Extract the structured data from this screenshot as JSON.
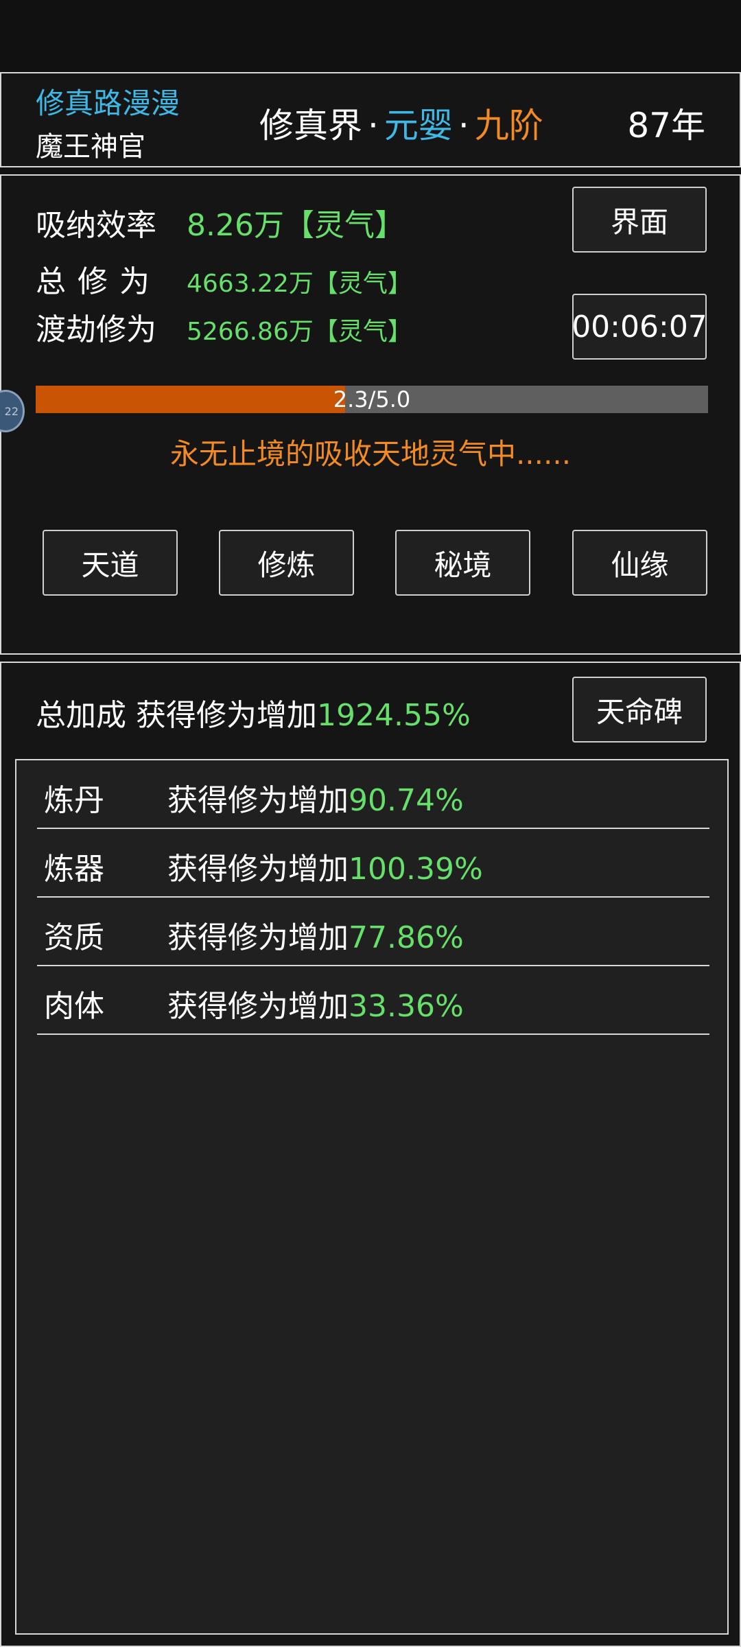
{
  "header": {
    "game_title": "修真路漫漫",
    "player_name": "魔王神官",
    "realm_world": "修真界",
    "realm_stage": "元婴",
    "realm_level": "九阶",
    "separator": "·",
    "years": "87年"
  },
  "stats": {
    "rate_label": "吸纳效率",
    "rate_value": "8.26万【灵气】",
    "total_label": "总修为",
    "total_value": "4663.22万【灵气】",
    "tribulation_label": "渡劫修为",
    "tribulation_value": "5266.86万【灵气】",
    "interface_button": "界面",
    "timer": "00:06:07",
    "progress_text": "2.3/5.0",
    "progress_fraction": 0.46,
    "status_message": "永无止境的吸收天地灵气中......",
    "side_bubble_text": "22"
  },
  "actions": {
    "tiandao": "天道",
    "xiulian": "修炼",
    "mijing": "秘境",
    "xianyuan": "仙缘"
  },
  "bonus": {
    "total_label": "总加成 获得修为增加",
    "total_value": "1924.55%",
    "stele_button": "天命碑",
    "items": [
      {
        "name": "炼丹",
        "desc": "获得修为增加",
        "value": "90.74%"
      },
      {
        "name": "炼器",
        "desc": "获得修为增加",
        "value": "100.39%"
      },
      {
        "name": "资质",
        "desc": "获得修为增加",
        "value": "77.86%"
      },
      {
        "name": "肉体",
        "desc": "获得修为增加",
        "value": "33.36%"
      }
    ]
  },
  "colors": {
    "accent_blue": "#3fb8e6",
    "accent_orange": "#f28b23",
    "value_green": "#66e06a",
    "progress_fill": "#c85404"
  }
}
